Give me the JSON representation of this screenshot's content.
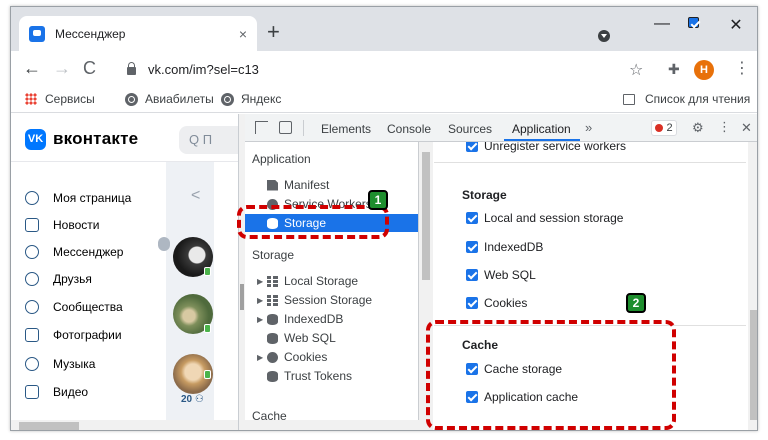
{
  "browser": {
    "tab_title": "Мессенджер",
    "tab_close": "×",
    "new_tab": "+",
    "url": "vk.com/im?sel=c13",
    "profile_initial": "H",
    "nav": {
      "back": "←",
      "forward": "→",
      "reload": "C"
    },
    "star": "☆",
    "extensions": "✚",
    "menu": "⋮",
    "window_controls": {
      "minimize": "—",
      "close": "✕"
    }
  },
  "bookmarks": {
    "items": [
      "Сервисы",
      "Авиабилеты",
      "Яндекс"
    ],
    "reading_list": "Список для чтения"
  },
  "vk": {
    "logo_mark": "VK",
    "brand": "вконтакте",
    "search_placeholder": "Q П",
    "menu": [
      "Моя страница",
      "Новости",
      "Мессенджер",
      "Друзья",
      "Сообщества",
      "Фотографии",
      "Музыка",
      "Видео"
    ],
    "back_arrow": "<",
    "member_count": "20 ⚇",
    "accent_color": "#0077ff"
  },
  "devtools": {
    "tabs": [
      "Elements",
      "Console",
      "Sources",
      "Application"
    ],
    "active_tab": "Application",
    "more_tabs": "»",
    "error_count": "2",
    "gear": "⚙",
    "dots": "⋮",
    "close": "✕",
    "sidebar": {
      "application_header": "Application",
      "application_items": [
        "Manifest",
        "Service Workers",
        "Storage"
      ],
      "selected_item": "Storage",
      "storage_header": "Storage",
      "storage_items": [
        "Local Storage",
        "Session Storage",
        "IndexedDB",
        "Web SQL",
        "Cookies",
        "Trust Tokens"
      ],
      "cache_header": "Cache"
    },
    "main": {
      "top_checkbox": "Unregister service workers",
      "storage_title": "Storage",
      "storage_options": [
        "Local and session storage",
        "IndexedDB",
        "Web SQL",
        "Cookies"
      ],
      "cache_title": "Cache",
      "cache_options": [
        "Cache storage",
        "Application cache"
      ]
    }
  },
  "annotations": {
    "badge1": "1",
    "badge2": "2",
    "highlight_color": "#d00000",
    "badge_color": "#1e8e2e"
  }
}
